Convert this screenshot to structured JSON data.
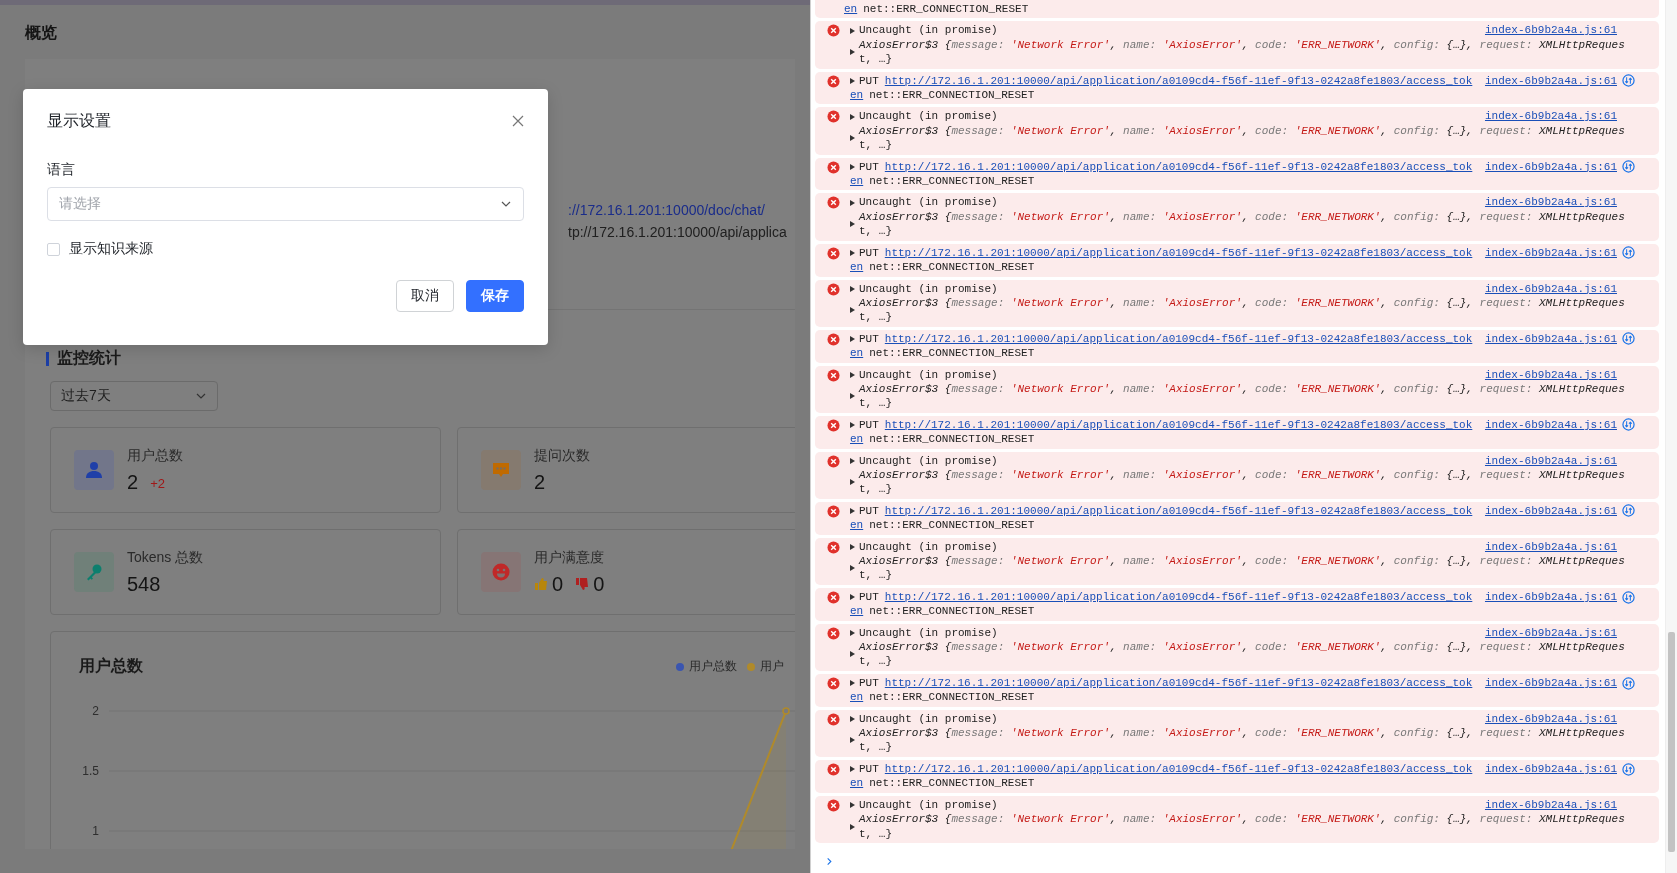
{
  "page": {
    "title": "概览",
    "links": [
      "://172.16.1.201:10000/doc/chat/",
      "tp://172.16.1.201:10000/api/applica"
    ],
    "section_title": "监控统计",
    "range_select": {
      "value": "过去7天"
    },
    "stats": [
      {
        "kind": "users",
        "label": "用户总数",
        "value": "2",
        "delta": "+2"
      },
      {
        "kind": "questions",
        "label": "提问次数",
        "value": "2"
      },
      {
        "kind": "tokens",
        "label": "Tokens 总数",
        "value": "548"
      },
      {
        "kind": "satisfaction",
        "label": "用户满意度",
        "likes": "0",
        "dislikes": "0"
      }
    ],
    "chart": {
      "title": "用户总数",
      "y_labels": [
        "2",
        "1.5",
        "1"
      ],
      "legend": [
        {
          "name": "用户总数",
          "color": "#3a55b0"
        },
        {
          "name": "用户",
          "color": "#b08a2a"
        }
      ]
    }
  },
  "dialog": {
    "title": "显示设置",
    "language_label": "语言",
    "language_select": {
      "placeholder": "请选择"
    },
    "show_source": {
      "label": "显示知识来源",
      "checked": false
    },
    "buttons": [
      {
        "kind": "cancel",
        "label": "取消"
      },
      {
        "kind": "primary",
        "label": "保存"
      }
    ]
  },
  "console": {
    "entries": [
      {
        "kind": "put_tail",
        "url_tail": "en",
        "message": "net::ERR_CONNECTION_RESET"
      },
      {
        "kind": "uncaught",
        "head": "Uncaught (in promise)",
        "source": "index-6b9b2a4a.js:61",
        "detail": [
          {
            "kind": "class",
            "text": "AxiosError$3 {"
          },
          {
            "kind": "key",
            "text": "message: "
          },
          {
            "kind": "string",
            "text": "'Network Error'"
          },
          {
            "kind": "plain",
            "text": ", "
          },
          {
            "kind": "key",
            "text": "name: "
          },
          {
            "kind": "string",
            "text": "'AxiosError'"
          },
          {
            "kind": "plain",
            "text": ", "
          },
          {
            "kind": "key",
            "text": "code: "
          },
          {
            "kind": "string",
            "text": "'ERR_NETWORK'"
          },
          {
            "kind": "plain",
            "text": ", "
          },
          {
            "kind": "key",
            "text": "config: "
          },
          {
            "kind": "plain",
            "text": "{…}, "
          },
          {
            "kind": "key",
            "text": "request: "
          },
          {
            "kind": "plain",
            "text": "XMLHttpReques"
          }
        ],
        "detail_tail": "t, …}"
      },
      {
        "kind": "put",
        "method": "PUT",
        "url": "http://172.16.1.201:10000/api/application/a0109cd4-f56f-11ef-9f13-0242a8fe1803/access_tok",
        "url_tail": "en",
        "source": "index-6b9b2a4a.js:61",
        "message": "net::ERR_CONNECTION_RESET"
      },
      {
        "kind": "uncaught",
        "head": "Uncaught (in promise)",
        "source": "index-6b9b2a4a.js:61",
        "detail": [
          {
            "kind": "class",
            "text": "AxiosError$3 {"
          },
          {
            "kind": "key",
            "text": "message: "
          },
          {
            "kind": "string",
            "text": "'Network Error'"
          },
          {
            "kind": "plain",
            "text": ", "
          },
          {
            "kind": "key",
            "text": "name: "
          },
          {
            "kind": "string",
            "text": "'AxiosError'"
          },
          {
            "kind": "plain",
            "text": ", "
          },
          {
            "kind": "key",
            "text": "code: "
          },
          {
            "kind": "string",
            "text": "'ERR_NETWORK'"
          },
          {
            "kind": "plain",
            "text": ", "
          },
          {
            "kind": "key",
            "text": "config: "
          },
          {
            "kind": "plain",
            "text": "{…}, "
          },
          {
            "kind": "key",
            "text": "request: "
          },
          {
            "kind": "plain",
            "text": "XMLHttpReques"
          }
        ],
        "detail_tail": "t, …}"
      },
      {
        "kind": "put",
        "method": "PUT",
        "url": "http://172.16.1.201:10000/api/application/a0109cd4-f56f-11ef-9f13-0242a8fe1803/access_tok",
        "url_tail": "en",
        "source": "index-6b9b2a4a.js:61",
        "message": "net::ERR_CONNECTION_RESET"
      },
      {
        "kind": "uncaught",
        "head": "Uncaught (in promise)",
        "source": "index-6b9b2a4a.js:61",
        "detail": [
          {
            "kind": "class",
            "text": "AxiosError$3 {"
          },
          {
            "kind": "key",
            "text": "message: "
          },
          {
            "kind": "string",
            "text": "'Network Error'"
          },
          {
            "kind": "plain",
            "text": ", "
          },
          {
            "kind": "key",
            "text": "name: "
          },
          {
            "kind": "string",
            "text": "'AxiosError'"
          },
          {
            "kind": "plain",
            "text": ", "
          },
          {
            "kind": "key",
            "text": "code: "
          },
          {
            "kind": "string",
            "text": "'ERR_NETWORK'"
          },
          {
            "kind": "plain",
            "text": ", "
          },
          {
            "kind": "key",
            "text": "config: "
          },
          {
            "kind": "plain",
            "text": "{…}, "
          },
          {
            "kind": "key",
            "text": "request: "
          },
          {
            "kind": "plain",
            "text": "XMLHttpReques"
          }
        ],
        "detail_tail": "t, …}"
      },
      {
        "kind": "put",
        "method": "PUT",
        "url": "http://172.16.1.201:10000/api/application/a0109cd4-f56f-11ef-9f13-0242a8fe1803/access_tok",
        "url_tail": "en",
        "source": "index-6b9b2a4a.js:61",
        "message": "net::ERR_CONNECTION_RESET"
      },
      {
        "kind": "uncaught",
        "head": "Uncaught (in promise)",
        "source": "index-6b9b2a4a.js:61",
        "detail": [
          {
            "kind": "class",
            "text": "AxiosError$3 {"
          },
          {
            "kind": "key",
            "text": "message: "
          },
          {
            "kind": "string",
            "text": "'Network Error'"
          },
          {
            "kind": "plain",
            "text": ", "
          },
          {
            "kind": "key",
            "text": "name: "
          },
          {
            "kind": "string",
            "text": "'AxiosError'"
          },
          {
            "kind": "plain",
            "text": ", "
          },
          {
            "kind": "key",
            "text": "code: "
          },
          {
            "kind": "string",
            "text": "'ERR_NETWORK'"
          },
          {
            "kind": "plain",
            "text": ", "
          },
          {
            "kind": "key",
            "text": "config: "
          },
          {
            "kind": "plain",
            "text": "{…}, "
          },
          {
            "kind": "key",
            "text": "request: "
          },
          {
            "kind": "plain",
            "text": "XMLHttpReques"
          }
        ],
        "detail_tail": "t, …}"
      },
      {
        "kind": "put",
        "method": "PUT",
        "url": "http://172.16.1.201:10000/api/application/a0109cd4-f56f-11ef-9f13-0242a8fe1803/access_tok",
        "url_tail": "en",
        "source": "index-6b9b2a4a.js:61",
        "message": "net::ERR_CONNECTION_RESET"
      },
      {
        "kind": "uncaught",
        "head": "Uncaught (in promise)",
        "source": "index-6b9b2a4a.js:61",
        "detail": [
          {
            "kind": "class",
            "text": "AxiosError$3 {"
          },
          {
            "kind": "key",
            "text": "message: "
          },
          {
            "kind": "string",
            "text": "'Network Error'"
          },
          {
            "kind": "plain",
            "text": ", "
          },
          {
            "kind": "key",
            "text": "name: "
          },
          {
            "kind": "string",
            "text": "'AxiosError'"
          },
          {
            "kind": "plain",
            "text": ", "
          },
          {
            "kind": "key",
            "text": "code: "
          },
          {
            "kind": "string",
            "text": "'ERR_NETWORK'"
          },
          {
            "kind": "plain",
            "text": ", "
          },
          {
            "kind": "key",
            "text": "config: "
          },
          {
            "kind": "plain",
            "text": "{…}, "
          },
          {
            "kind": "key",
            "text": "request: "
          },
          {
            "kind": "plain",
            "text": "XMLHttpReques"
          }
        ],
        "detail_tail": "t, …}"
      },
      {
        "kind": "put",
        "method": "PUT",
        "url": "http://172.16.1.201:10000/api/application/a0109cd4-f56f-11ef-9f13-0242a8fe1803/access_tok",
        "url_tail": "en",
        "source": "index-6b9b2a4a.js:61",
        "message": "net::ERR_CONNECTION_RESET"
      },
      {
        "kind": "uncaught",
        "head": "Uncaught (in promise)",
        "source": "index-6b9b2a4a.js:61",
        "detail": [
          {
            "kind": "class",
            "text": "AxiosError$3 {"
          },
          {
            "kind": "key",
            "text": "message: "
          },
          {
            "kind": "string",
            "text": "'Network Error'"
          },
          {
            "kind": "plain",
            "text": ", "
          },
          {
            "kind": "key",
            "text": "name: "
          },
          {
            "kind": "string",
            "text": "'AxiosError'"
          },
          {
            "kind": "plain",
            "text": ", "
          },
          {
            "kind": "key",
            "text": "code: "
          },
          {
            "kind": "string",
            "text": "'ERR_NETWORK'"
          },
          {
            "kind": "plain",
            "text": ", "
          },
          {
            "kind": "key",
            "text": "config: "
          },
          {
            "kind": "plain",
            "text": "{…}, "
          },
          {
            "kind": "key",
            "text": "request: "
          },
          {
            "kind": "plain",
            "text": "XMLHttpReques"
          }
        ],
        "detail_tail": "t, …}"
      },
      {
        "kind": "put",
        "method": "PUT",
        "url": "http://172.16.1.201:10000/api/application/a0109cd4-f56f-11ef-9f13-0242a8fe1803/access_tok",
        "url_tail": "en",
        "source": "index-6b9b2a4a.js:61",
        "message": "net::ERR_CONNECTION_RESET"
      },
      {
        "kind": "uncaught",
        "head": "Uncaught (in promise)",
        "source": "index-6b9b2a4a.js:61",
        "detail": [
          {
            "kind": "class",
            "text": "AxiosError$3 {"
          },
          {
            "kind": "key",
            "text": "message: "
          },
          {
            "kind": "string",
            "text": "'Network Error'"
          },
          {
            "kind": "plain",
            "text": ", "
          },
          {
            "kind": "key",
            "text": "name: "
          },
          {
            "kind": "string",
            "text": "'AxiosError'"
          },
          {
            "kind": "plain",
            "text": ", "
          },
          {
            "kind": "key",
            "text": "code: "
          },
          {
            "kind": "string",
            "text": "'ERR_NETWORK'"
          },
          {
            "kind": "plain",
            "text": ", "
          },
          {
            "kind": "key",
            "text": "config: "
          },
          {
            "kind": "plain",
            "text": "{…}, "
          },
          {
            "kind": "key",
            "text": "request: "
          },
          {
            "kind": "plain",
            "text": "XMLHttpReques"
          }
        ],
        "detail_tail": "t, …}"
      },
      {
        "kind": "put",
        "method": "PUT",
        "url": "http://172.16.1.201:10000/api/application/a0109cd4-f56f-11ef-9f13-0242a8fe1803/access_tok",
        "url_tail": "en",
        "source": "index-6b9b2a4a.js:61",
        "message": "net::ERR_CONNECTION_RESET"
      },
      {
        "kind": "uncaught",
        "head": "Uncaught (in promise)",
        "source": "index-6b9b2a4a.js:61",
        "detail": [
          {
            "kind": "class",
            "text": "AxiosError$3 {"
          },
          {
            "kind": "key",
            "text": "message: "
          },
          {
            "kind": "string",
            "text": "'Network Error'"
          },
          {
            "kind": "plain",
            "text": ", "
          },
          {
            "kind": "key",
            "text": "name: "
          },
          {
            "kind": "string",
            "text": "'AxiosError'"
          },
          {
            "kind": "plain",
            "text": ", "
          },
          {
            "kind": "key",
            "text": "code: "
          },
          {
            "kind": "string",
            "text": "'ERR_NETWORK'"
          },
          {
            "kind": "plain",
            "text": ", "
          },
          {
            "kind": "key",
            "text": "config: "
          },
          {
            "kind": "plain",
            "text": "{…}, "
          },
          {
            "kind": "key",
            "text": "request: "
          },
          {
            "kind": "plain",
            "text": "XMLHttpReques"
          }
        ],
        "detail_tail": "t, …}"
      },
      {
        "kind": "put",
        "method": "PUT",
        "url": "http://172.16.1.201:10000/api/application/a0109cd4-f56f-11ef-9f13-0242a8fe1803/access_tok",
        "url_tail": "en",
        "source": "index-6b9b2a4a.js:61",
        "message": "net::ERR_CONNECTION_RESET"
      },
      {
        "kind": "uncaught",
        "head": "Uncaught (in promise)",
        "source": "index-6b9b2a4a.js:61",
        "detail": [
          {
            "kind": "class",
            "text": "AxiosError$3 {"
          },
          {
            "kind": "key",
            "text": "message: "
          },
          {
            "kind": "string",
            "text": "'Network Error'"
          },
          {
            "kind": "plain",
            "text": ", "
          },
          {
            "kind": "key",
            "text": "name: "
          },
          {
            "kind": "string",
            "text": "'AxiosError'"
          },
          {
            "kind": "plain",
            "text": ", "
          },
          {
            "kind": "key",
            "text": "code: "
          },
          {
            "kind": "string",
            "text": "'ERR_NETWORK'"
          },
          {
            "kind": "plain",
            "text": ", "
          },
          {
            "kind": "key",
            "text": "config: "
          },
          {
            "kind": "plain",
            "text": "{…}, "
          },
          {
            "kind": "key",
            "text": "request: "
          },
          {
            "kind": "plain",
            "text": "XMLHttpReques"
          }
        ],
        "detail_tail": "t, …}"
      },
      {
        "kind": "put",
        "method": "PUT",
        "url": "http://172.16.1.201:10000/api/application/a0109cd4-f56f-11ef-9f13-0242a8fe1803/access_tok",
        "url_tail": "en",
        "source": "index-6b9b2a4a.js:61",
        "message": "net::ERR_CONNECTION_RESET"
      },
      {
        "kind": "uncaught",
        "head": "Uncaught (in promise)",
        "source": "index-6b9b2a4a.js:61",
        "detail": [
          {
            "kind": "class",
            "text": "AxiosError$3 {"
          },
          {
            "kind": "key",
            "text": "message: "
          },
          {
            "kind": "string",
            "text": "'Network Error'"
          },
          {
            "kind": "plain",
            "text": ", "
          },
          {
            "kind": "key",
            "text": "name: "
          },
          {
            "kind": "string",
            "text": "'AxiosError'"
          },
          {
            "kind": "plain",
            "text": ", "
          },
          {
            "kind": "key",
            "text": "code: "
          },
          {
            "kind": "string",
            "text": "'ERR_NETWORK'"
          },
          {
            "kind": "plain",
            "text": ", "
          },
          {
            "kind": "key",
            "text": "config: "
          },
          {
            "kind": "plain",
            "text": "{…}, "
          },
          {
            "kind": "key",
            "text": "request: "
          },
          {
            "kind": "plain",
            "text": "XMLHttpReques"
          }
        ],
        "detail_tail": "t, …}"
      }
    ]
  }
}
